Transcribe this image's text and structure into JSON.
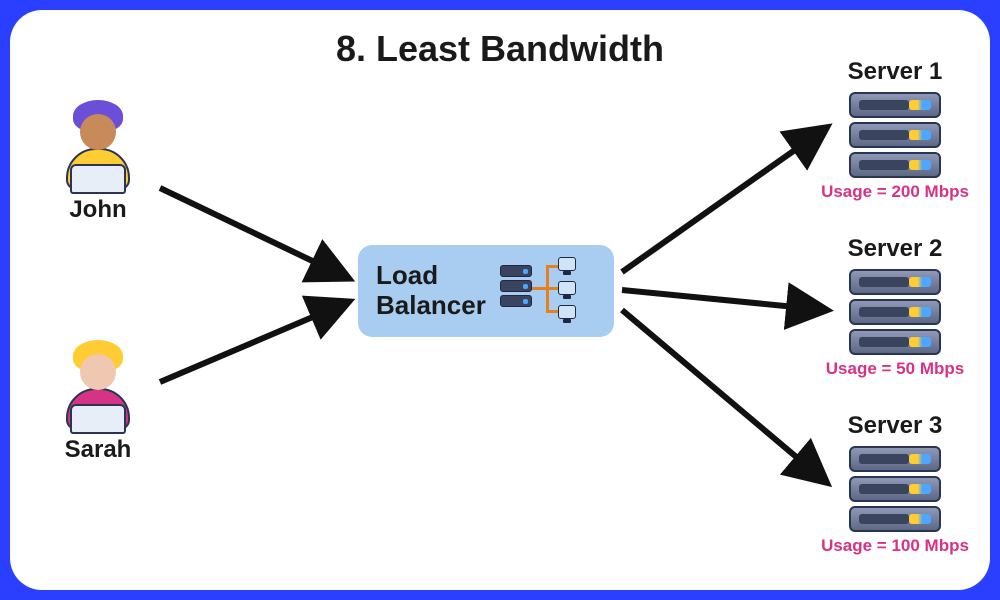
{
  "title": "8. Least Bandwidth",
  "users": [
    {
      "name": "John",
      "hair": "#6b4fd8",
      "face": "#c98a5a",
      "body": "#ffcc33"
    },
    {
      "name": "Sarah",
      "hair": "#ffcc33",
      "face": "#f0c7b0",
      "body": "#d63384"
    }
  ],
  "load_balancer": {
    "label_line1": "Load",
    "label_line2": "Balancer"
  },
  "servers": [
    {
      "name": "Server 1",
      "usage": "Usage = 200 Mbps"
    },
    {
      "name": "Server 2",
      "usage": "Usage = 50 Mbps"
    },
    {
      "name": "Server 3",
      "usage": "Usage = 100 Mbps"
    }
  ]
}
